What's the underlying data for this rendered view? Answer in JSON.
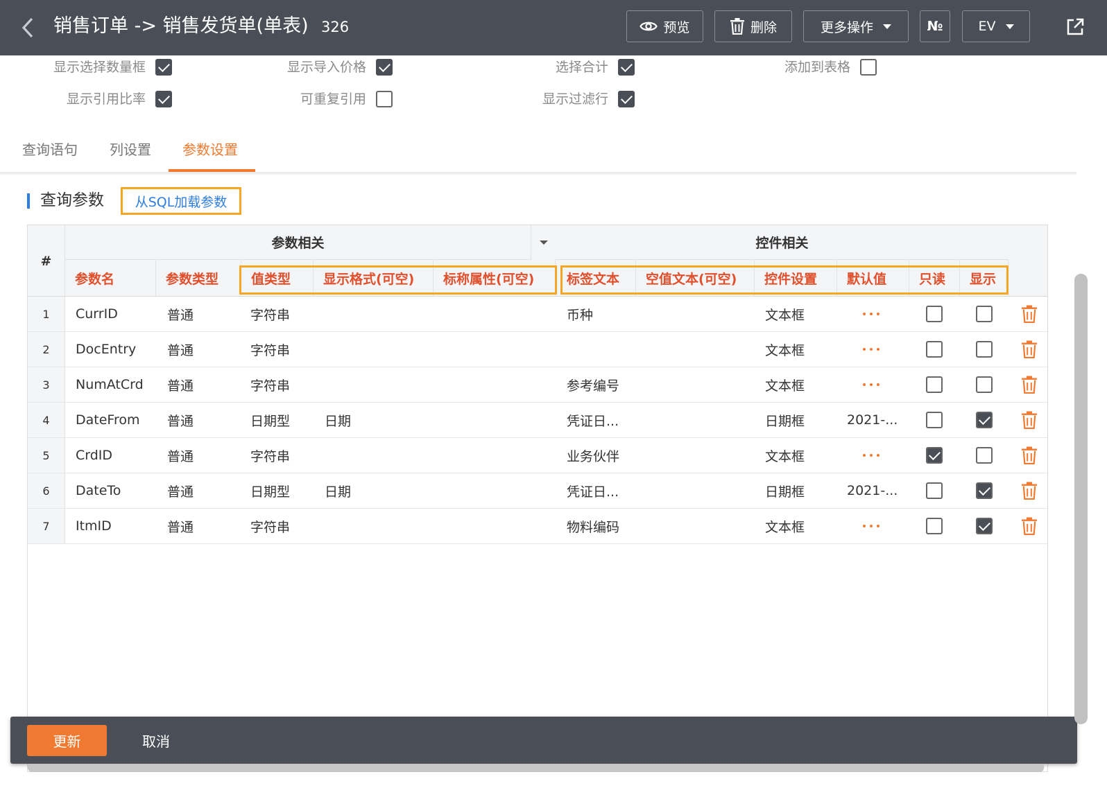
{
  "header": {
    "title": "销售订单 -> 销售发货单(单表)",
    "doc_number": "326",
    "buttons": {
      "preview": "预览",
      "delete": "删除",
      "more": "更多操作",
      "no": "№",
      "ev": "EV"
    }
  },
  "options": [
    {
      "label": "显示选择数量框",
      "checked": true
    },
    {
      "label": "显示导入价格",
      "checked": true
    },
    {
      "label": "选择合计",
      "checked": true
    },
    {
      "label": "添加到表格",
      "checked": false
    },
    {
      "label": "显示引用比率",
      "checked": true
    },
    {
      "label": "可重复引用",
      "checked": false
    },
    {
      "label": "显示过滤行",
      "checked": true
    }
  ],
  "tabs": [
    "查询语句",
    "列设置",
    "参数设置"
  ],
  "active_tab": "参数设置",
  "section": {
    "title": "查询参数",
    "load_button": "从SQL加载参数"
  },
  "table": {
    "hash": "#",
    "group_param": "参数相关",
    "group_control": "控件相关",
    "columns": [
      "参数名",
      "参数类型",
      "值类型",
      "显示格式(可空)",
      "标称属性(可空)",
      "标签文本",
      "空值文本(可空)",
      "控件设置",
      "默认值",
      "只读",
      "显示"
    ],
    "rows": [
      {
        "num": "1",
        "name": "CurrID",
        "ptype": "普通",
        "vtype": "字符串",
        "format": "",
        "label": "币种",
        "control": "文本框",
        "default": "",
        "readonly": false,
        "show": false
      },
      {
        "num": "2",
        "name": "DocEntry",
        "ptype": "普通",
        "vtype": "字符串",
        "format": "",
        "label": "",
        "control": "文本框",
        "default": "",
        "readonly": false,
        "show": false
      },
      {
        "num": "3",
        "name": "NumAtCrd",
        "ptype": "普通",
        "vtype": "字符串",
        "format": "",
        "label": "参考编号",
        "control": "文本框",
        "default": "",
        "readonly": false,
        "show": false
      },
      {
        "num": "4",
        "name": "DateFrom",
        "ptype": "普通",
        "vtype": "日期型",
        "format": "日期",
        "label": "凭证日...",
        "control": "日期框",
        "default": "2021-...",
        "readonly": false,
        "show": true
      },
      {
        "num": "5",
        "name": "CrdID",
        "ptype": "普通",
        "vtype": "字符串",
        "format": "",
        "label": "业务伙伴",
        "control": "文本框",
        "default": "",
        "readonly": true,
        "show": false
      },
      {
        "num": "6",
        "name": "DateTo",
        "ptype": "普通",
        "vtype": "日期型",
        "format": "日期",
        "label": "凭证日...",
        "control": "日期框",
        "default": "2021-...",
        "readonly": false,
        "show": true
      },
      {
        "num": "7",
        "name": "ItmID",
        "ptype": "普通",
        "vtype": "字符串",
        "format": "",
        "label": "物料编码",
        "control": "文本框",
        "default": "",
        "readonly": false,
        "show": true
      }
    ]
  },
  "footer": {
    "update": "更新",
    "cancel": "取消"
  },
  "colors": {
    "header_bg": "#4a4e56",
    "accent": "#f07a32",
    "link": "#2e7de0",
    "highlight": "#f5a623",
    "column_header_text": "#e0502d"
  }
}
